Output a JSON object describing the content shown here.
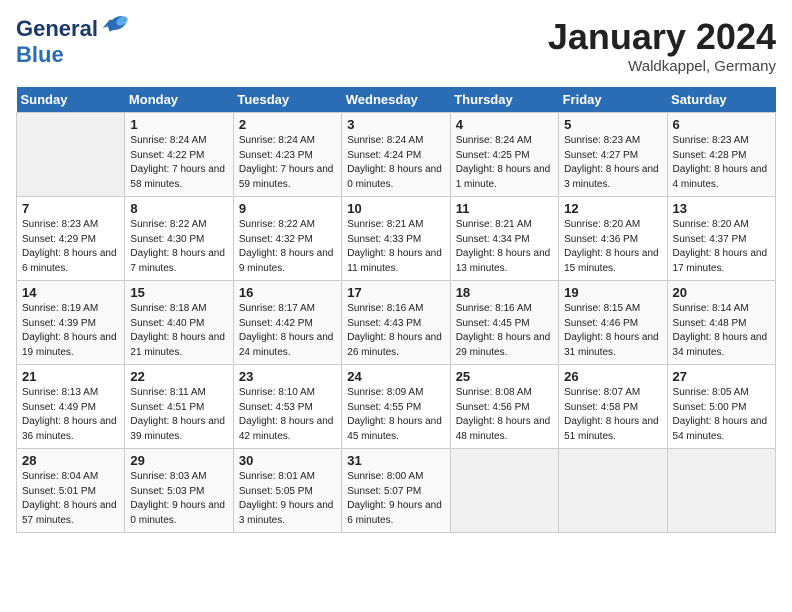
{
  "header": {
    "logo_line1": "General",
    "logo_line2": "Blue",
    "month": "January 2024",
    "location": "Waldkappel, Germany"
  },
  "weekdays": [
    "Sunday",
    "Monday",
    "Tuesday",
    "Wednesday",
    "Thursday",
    "Friday",
    "Saturday"
  ],
  "weeks": [
    [
      {
        "day": "",
        "empty": true
      },
      {
        "day": "1",
        "sunrise": "8:24 AM",
        "sunset": "4:22 PM",
        "daylight": "7 hours and 58 minutes."
      },
      {
        "day": "2",
        "sunrise": "8:24 AM",
        "sunset": "4:23 PM",
        "daylight": "7 hours and 59 minutes."
      },
      {
        "day": "3",
        "sunrise": "8:24 AM",
        "sunset": "4:24 PM",
        "daylight": "8 hours and 0 minutes."
      },
      {
        "day": "4",
        "sunrise": "8:24 AM",
        "sunset": "4:25 PM",
        "daylight": "8 hours and 1 minute."
      },
      {
        "day": "5",
        "sunrise": "8:23 AM",
        "sunset": "4:27 PM",
        "daylight": "8 hours and 3 minutes."
      },
      {
        "day": "6",
        "sunrise": "8:23 AM",
        "sunset": "4:28 PM",
        "daylight": "8 hours and 4 minutes."
      }
    ],
    [
      {
        "day": "7",
        "sunrise": "8:23 AM",
        "sunset": "4:29 PM",
        "daylight": "8 hours and 6 minutes."
      },
      {
        "day": "8",
        "sunrise": "8:22 AM",
        "sunset": "4:30 PM",
        "daylight": "8 hours and 7 minutes."
      },
      {
        "day": "9",
        "sunrise": "8:22 AM",
        "sunset": "4:32 PM",
        "daylight": "8 hours and 9 minutes."
      },
      {
        "day": "10",
        "sunrise": "8:21 AM",
        "sunset": "4:33 PM",
        "daylight": "8 hours and 11 minutes."
      },
      {
        "day": "11",
        "sunrise": "8:21 AM",
        "sunset": "4:34 PM",
        "daylight": "8 hours and 13 minutes."
      },
      {
        "day": "12",
        "sunrise": "8:20 AM",
        "sunset": "4:36 PM",
        "daylight": "8 hours and 15 minutes."
      },
      {
        "day": "13",
        "sunrise": "8:20 AM",
        "sunset": "4:37 PM",
        "daylight": "8 hours and 17 minutes."
      }
    ],
    [
      {
        "day": "14",
        "sunrise": "8:19 AM",
        "sunset": "4:39 PM",
        "daylight": "8 hours and 19 minutes."
      },
      {
        "day": "15",
        "sunrise": "8:18 AM",
        "sunset": "4:40 PM",
        "daylight": "8 hours and 21 minutes."
      },
      {
        "day": "16",
        "sunrise": "8:17 AM",
        "sunset": "4:42 PM",
        "daylight": "8 hours and 24 minutes."
      },
      {
        "day": "17",
        "sunrise": "8:16 AM",
        "sunset": "4:43 PM",
        "daylight": "8 hours and 26 minutes."
      },
      {
        "day": "18",
        "sunrise": "8:16 AM",
        "sunset": "4:45 PM",
        "daylight": "8 hours and 29 minutes."
      },
      {
        "day": "19",
        "sunrise": "8:15 AM",
        "sunset": "4:46 PM",
        "daylight": "8 hours and 31 minutes."
      },
      {
        "day": "20",
        "sunrise": "8:14 AM",
        "sunset": "4:48 PM",
        "daylight": "8 hours and 34 minutes."
      }
    ],
    [
      {
        "day": "21",
        "sunrise": "8:13 AM",
        "sunset": "4:49 PM",
        "daylight": "8 hours and 36 minutes."
      },
      {
        "day": "22",
        "sunrise": "8:11 AM",
        "sunset": "4:51 PM",
        "daylight": "8 hours and 39 minutes."
      },
      {
        "day": "23",
        "sunrise": "8:10 AM",
        "sunset": "4:53 PM",
        "daylight": "8 hours and 42 minutes."
      },
      {
        "day": "24",
        "sunrise": "8:09 AM",
        "sunset": "4:55 PM",
        "daylight": "8 hours and 45 minutes."
      },
      {
        "day": "25",
        "sunrise": "8:08 AM",
        "sunset": "4:56 PM",
        "daylight": "8 hours and 48 minutes."
      },
      {
        "day": "26",
        "sunrise": "8:07 AM",
        "sunset": "4:58 PM",
        "daylight": "8 hours and 51 minutes."
      },
      {
        "day": "27",
        "sunrise": "8:05 AM",
        "sunset": "5:00 PM",
        "daylight": "8 hours and 54 minutes."
      }
    ],
    [
      {
        "day": "28",
        "sunrise": "8:04 AM",
        "sunset": "5:01 PM",
        "daylight": "8 hours and 57 minutes."
      },
      {
        "day": "29",
        "sunrise": "8:03 AM",
        "sunset": "5:03 PM",
        "daylight": "9 hours and 0 minutes."
      },
      {
        "day": "30",
        "sunrise": "8:01 AM",
        "sunset": "5:05 PM",
        "daylight": "9 hours and 3 minutes."
      },
      {
        "day": "31",
        "sunrise": "8:00 AM",
        "sunset": "5:07 PM",
        "daylight": "9 hours and 6 minutes."
      },
      {
        "day": "",
        "empty": true
      },
      {
        "day": "",
        "empty": true
      },
      {
        "day": "",
        "empty": true
      }
    ]
  ],
  "labels": {
    "sunrise": "Sunrise:",
    "sunset": "Sunset:",
    "daylight": "Daylight:"
  }
}
